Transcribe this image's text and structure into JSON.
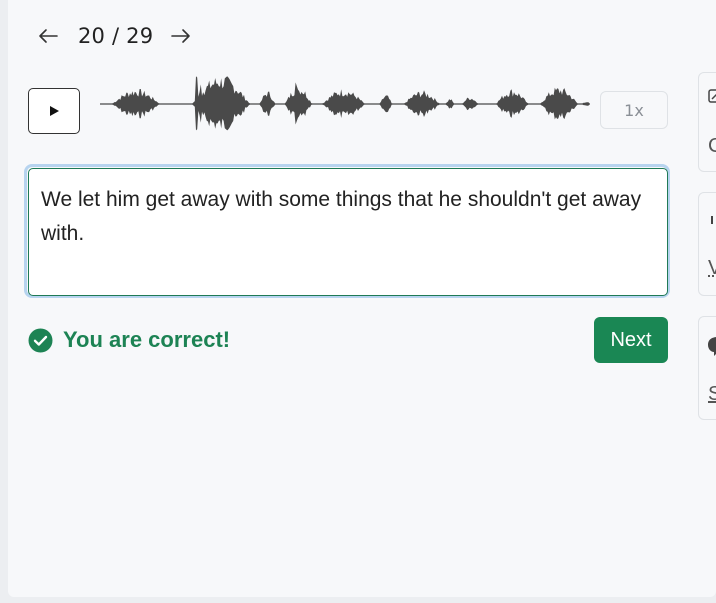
{
  "navigation": {
    "prev_icon": "arrow-left-icon",
    "counter": "20 / 29",
    "next_icon": "arrow-right-icon"
  },
  "player": {
    "play_icon": "play-icon",
    "speed_label": "1x"
  },
  "answer": {
    "text": "We let him get away with some things that he shouldn't get away with."
  },
  "feedback": {
    "icon": "check-circle-icon",
    "message": "You are correct!",
    "color": "#1d8354"
  },
  "actions": {
    "next_label": "Next",
    "accent_color": "#1a8754"
  },
  "side_cards": [
    {
      "icon": "edit-icon",
      "letter": "C"
    },
    {
      "icon": "sound-icon",
      "letter": "V"
    },
    {
      "icon": "chat-bubble-icon",
      "letter": "S"
    }
  ]
}
